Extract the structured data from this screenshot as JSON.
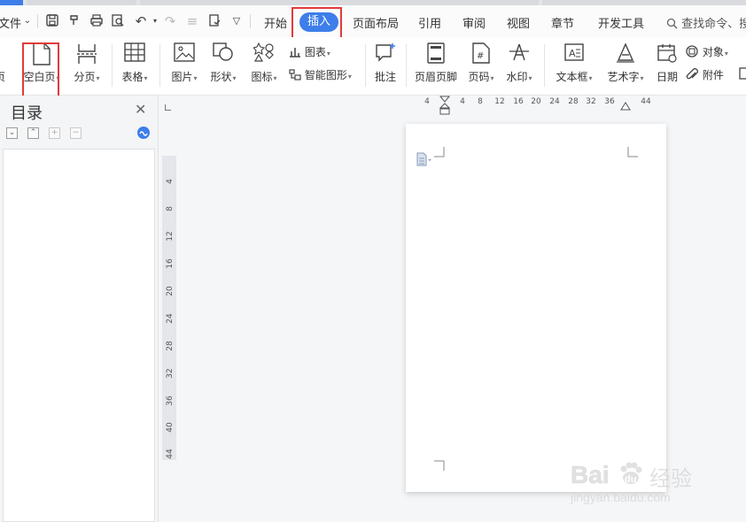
{
  "menubar": {
    "file_partial": "文件",
    "tabs": [
      {
        "key": "home",
        "label": "开始"
      },
      {
        "key": "insert",
        "label": "插入",
        "active": true
      },
      {
        "key": "layout",
        "label": "页面布局"
      },
      {
        "key": "references",
        "label": "引用"
      },
      {
        "key": "review",
        "label": "审阅"
      },
      {
        "key": "view",
        "label": "视图"
      },
      {
        "key": "section",
        "label": "章节"
      },
      {
        "key": "dev",
        "label": "开发工具"
      }
    ],
    "search_text": "查找命令、搜"
  },
  "ribbon": {
    "partial_label": "页",
    "blank_page": "空白页",
    "page_break": "分页",
    "table": "表格",
    "picture": "图片",
    "shape": "形状",
    "icon": "图标",
    "chart": "图表",
    "smart_art": "智能图形",
    "comment": "批注",
    "header_footer": "页眉页脚",
    "page_number": "页码",
    "watermark": "水印",
    "text_box": "文本框",
    "word_art": "艺术字",
    "date": "日期",
    "object": "对象",
    "attachment": "附件"
  },
  "sidebar": {
    "title": "目录"
  },
  "rulers": {
    "horizontal": [
      "4",
      "4",
      "8",
      "12",
      "16",
      "20",
      "24",
      "28",
      "32",
      "36",
      "44"
    ],
    "vertical": [
      "4",
      "8",
      "12",
      "16",
      "20",
      "24",
      "28",
      "32",
      "36",
      "40",
      "44"
    ]
  },
  "watermark": {
    "brand": "Baidu经验",
    "url": "jingyan.baidu.com"
  },
  "colors": {
    "accent": "#3d7eea",
    "highlight_box": "#e23a3a"
  }
}
